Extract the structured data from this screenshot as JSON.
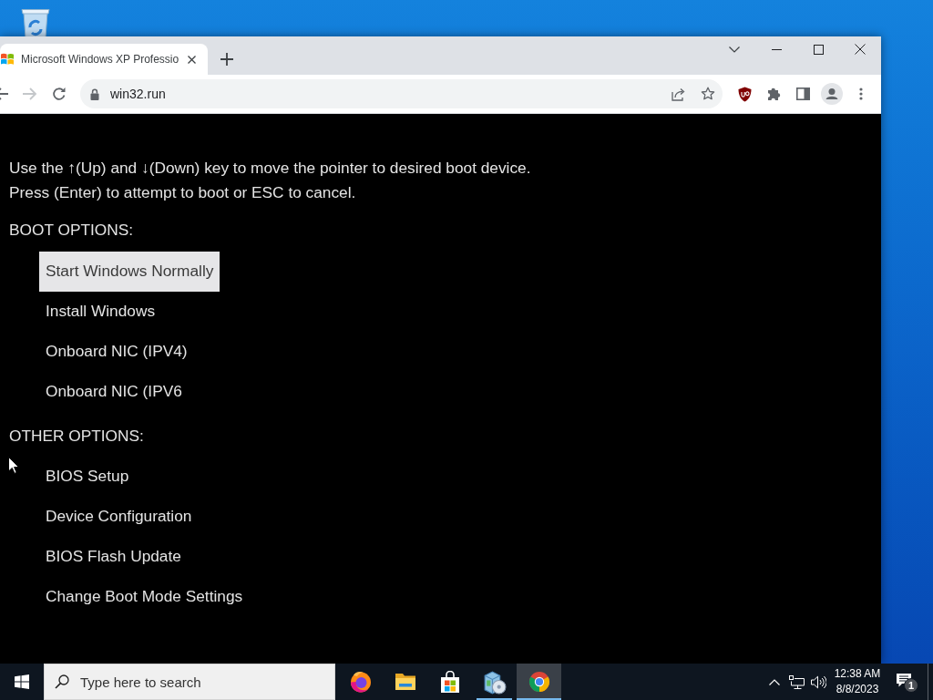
{
  "browser": {
    "tab": {
      "title": "Microsoft Windows XP Professio",
      "selected": true
    },
    "back": {
      "disabled": false
    },
    "forward": {
      "disabled": true
    },
    "address": "win32.run"
  },
  "boot_menu": {
    "instructions": [
      "Use the ↑(Up) and ↓(Down) key to move the pointer to desired boot device.",
      "Press (Enter) to attempt to boot or ESC to cancel."
    ],
    "sections": [
      {
        "heading": "BOOT OPTIONS:",
        "items": [
          {
            "label": "Start Windows Normally",
            "selected": true
          },
          {
            "label": "Install Windows",
            "selected": false
          },
          {
            "label": "Onboard NIC (IPV4)",
            "selected": false
          },
          {
            "label": "Onboard NIC (IPV6",
            "selected": false
          }
        ]
      },
      {
        "heading": "OTHER OPTIONS:",
        "items": [
          {
            "label": "BIOS Setup",
            "selected": false
          },
          {
            "label": "Device Configuration",
            "selected": false
          },
          {
            "label": "BIOS Flash Update",
            "selected": false
          },
          {
            "label": "Change Boot Mode Settings",
            "selected": false
          }
        ]
      }
    ]
  },
  "taskbar": {
    "search": {
      "placeholder": "Type here to search"
    },
    "apps": [
      {
        "kind": "firefox",
        "running": false,
        "selected": false
      },
      {
        "kind": "file_explorer",
        "running": false,
        "selected": false
      },
      {
        "kind": "store",
        "running": false,
        "selected": false
      },
      {
        "kind": "installer",
        "running": true,
        "selected": false
      },
      {
        "kind": "chrome",
        "running": true,
        "selected": true
      }
    ],
    "clock": {
      "time": "12:38 AM",
      "date": "8/8/2023"
    },
    "notifications": {
      "count": "1"
    }
  }
}
